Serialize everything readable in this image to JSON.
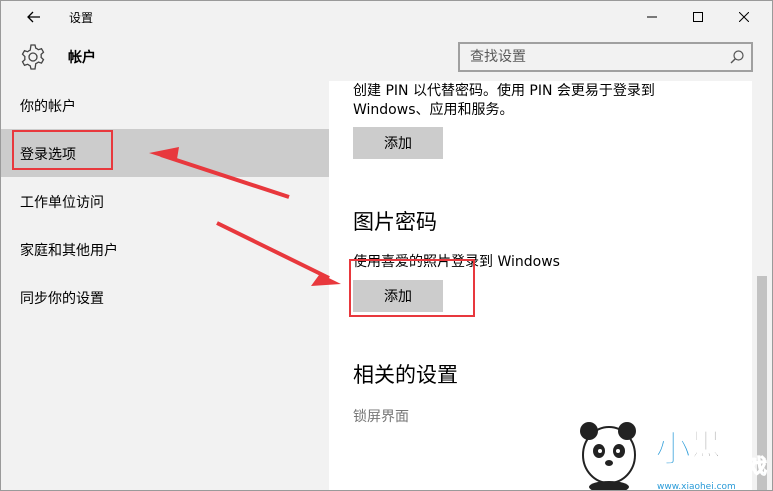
{
  "window": {
    "title": "设置"
  },
  "header": {
    "section_title": "帐户",
    "search_placeholder": "查找设置"
  },
  "sidebar": {
    "items": [
      {
        "label": "你的帐户"
      },
      {
        "label": "登录选项",
        "selected": true
      },
      {
        "label": "工作单位访问"
      },
      {
        "label": "家庭和其他用户"
      },
      {
        "label": "同步你的设置"
      }
    ]
  },
  "main": {
    "pin_desc_line1": "创建 PIN 以代替密码。使用 PIN 会更易于登录到",
    "pin_desc_line2": "Windows、应用和服务。",
    "pin_add_button": "添加",
    "picture_password_heading": "图片密码",
    "picture_password_desc": "使用喜爱的照片登录到 Windows",
    "picture_add_button": "添加",
    "related_heading": "相关的设置",
    "lock_screen_link": "锁屏界面"
  },
  "watermark": {
    "brand": "小黑游戏",
    "url": "www.xiaohei.com"
  },
  "colors": {
    "annotation_red": "#e8383d",
    "sidebar_bg": "#f2f2f2",
    "selected_bg": "#cccccc",
    "button_bg": "#cccccc",
    "link_gray": "#767676"
  }
}
